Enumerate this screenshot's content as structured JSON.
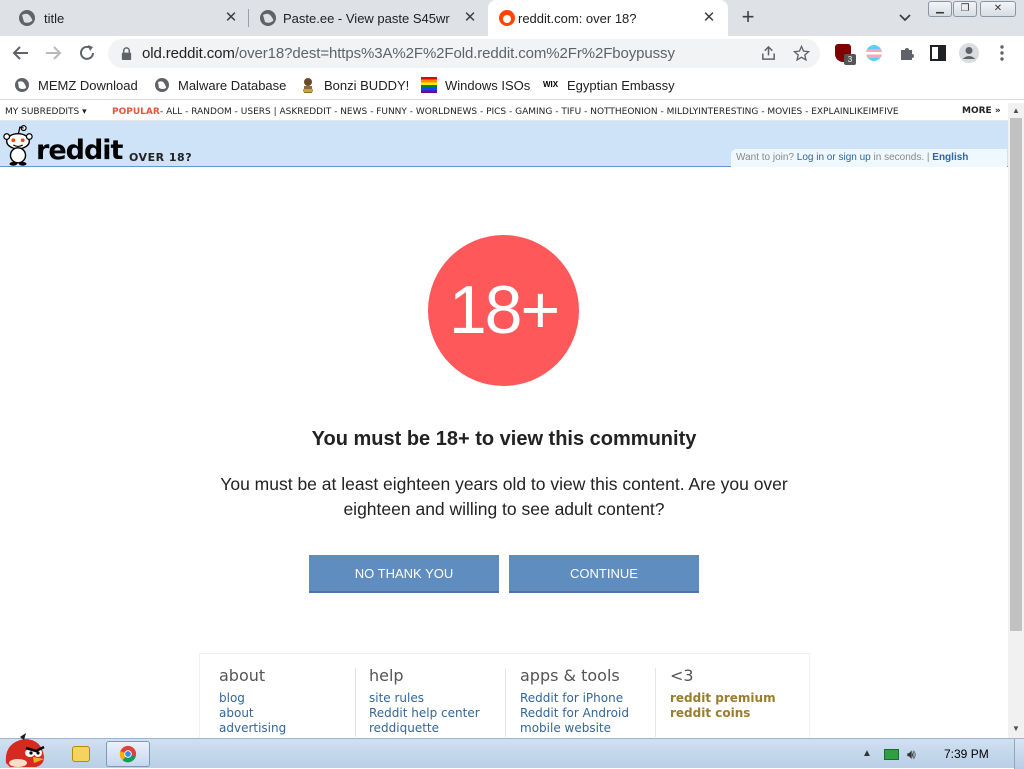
{
  "browser": {
    "tabs": [
      {
        "title": "title",
        "active": false
      },
      {
        "title": "Paste.ee - View paste S45wr",
        "active": false
      },
      {
        "title": "reddit.com: over 18?",
        "active": true
      }
    ],
    "url_host": "old.reddit.com",
    "url_rest": "/over18?dest=https%3A%2F%2Fold.reddit.com%2Fr%2Fboypussy",
    "extension_badge": "3",
    "bookmarks": [
      {
        "label": "MEMZ Download",
        "icon": "globe-icon"
      },
      {
        "label": "Malware Database",
        "icon": "globe-icon"
      },
      {
        "label": "Bonzi BUDDY!",
        "icon": "bonzi-icon"
      },
      {
        "label": "Windows ISOs",
        "icon": "rainbow-flag-icon"
      },
      {
        "label": "Egyptian Embassy",
        "icon": "wix-icon"
      }
    ]
  },
  "reddit": {
    "sr_bar": {
      "my_subreddits": "MY SUBREDDITS",
      "popular": "POPULAR",
      "items": "- ALL - RANDOM - USERS | ASKREDDIT - NEWS - FUNNY - WORLDNEWS - PICS - GAMING - TIFU - NOTTHEONION - MILDLYINTERESTING - MOVIES - EXPLAINLIKEIMFIVE",
      "more": "MORE »"
    },
    "header": {
      "wordmark": "reddit",
      "page_name": "OVER 18?",
      "join_prefix": "Want to join?",
      "join_link": "Log in or sign up",
      "join_suffix": "in seconds.",
      "separator": "|",
      "language": "English"
    },
    "gate": {
      "badge": "18+",
      "heading": "You must be 18+ to view this community",
      "description": "You must be at least eighteen years old to view this content. Are you over eighteen and willing to see adult content?",
      "decline_label": "NO THANK YOU",
      "accept_label": "CONTINUE"
    },
    "footer": {
      "columns": [
        {
          "title": "about",
          "links": [
            "blog",
            "about",
            "advertising"
          ]
        },
        {
          "title": "help",
          "links": [
            "site rules",
            "Reddit help center",
            "reddiquette"
          ]
        },
        {
          "title": "apps & tools",
          "links": [
            "Reddit for iPhone",
            "Reddit for Android",
            "mobile website"
          ]
        },
        {
          "title": "<3",
          "links": [
            "reddit premium",
            "reddit coins"
          ]
        }
      ]
    }
  },
  "taskbar": {
    "clock": "7:39 PM"
  },
  "colors": {
    "badge": "#ff585b",
    "button": "#5f8dbf",
    "header_bg": "#cee3f8",
    "popular": "#e3583b"
  }
}
